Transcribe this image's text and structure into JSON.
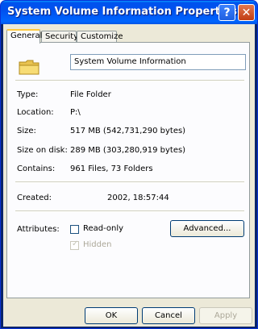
{
  "window": {
    "title": "System Volume Information Properties",
    "help_label": "?",
    "close_label": "✕"
  },
  "tabs": [
    {
      "label": "General",
      "active": true
    },
    {
      "label": "Security",
      "active": false
    },
    {
      "label": "Customize",
      "active": false
    }
  ],
  "general": {
    "name": "System Volume Information",
    "icon": "folder-icon",
    "type_label": "Type:",
    "type_value": "File Folder",
    "location_label": "Location:",
    "location_value": "P:\\",
    "size_label": "Size:",
    "size_value": "517 MB (542,731,290 bytes)",
    "size_on_disk_label": "Size on disk:",
    "size_on_disk_value": "289 MB (303,280,919 bytes)",
    "contains_label": "Contains:",
    "contains_value": "961 Files, 73 Folders",
    "created_label": "Created:",
    "created_value": "2002, 18:57:44",
    "attributes_label": "Attributes:",
    "readonly_label": "Read-only",
    "readonly_checked": false,
    "hidden_label": "Hidden",
    "hidden_checked": true,
    "advanced_label": "Advanced..."
  },
  "buttons": {
    "ok": "OK",
    "cancel": "Cancel",
    "apply": "Apply"
  },
  "colors": {
    "titlebar": "#0054e3",
    "client_bg": "#ece9d8",
    "tab_highlight": "#ffc83c"
  }
}
